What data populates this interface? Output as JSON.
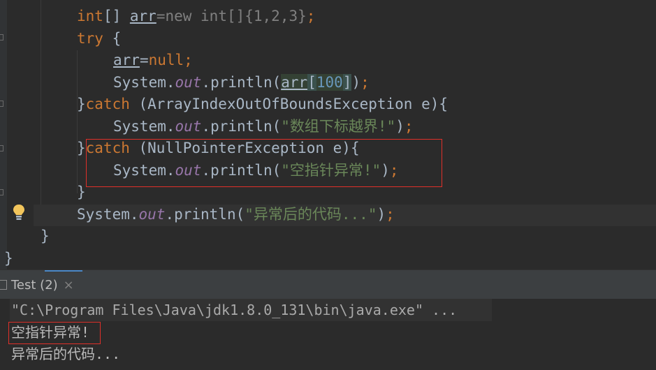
{
  "editor": {
    "lines": {
      "l1": {
        "kw_int": "int",
        "brackets": "[] ",
        "var": "arr",
        "eq": "=",
        "init": "new int[]{1,2,3}",
        "semi": ";"
      },
      "l2": {
        "kw_try": "try",
        "brace": " {"
      },
      "l3": {
        "var": "arr",
        "eq": "=",
        "kw_null": "null",
        "semi": ";"
      },
      "l4": {
        "sys": "System.",
        "out": "out",
        "call": ".println(",
        "var": "arr",
        "open": "[",
        "index": "100",
        "close": "]",
        "paren": ")",
        "semi": ";"
      },
      "l5": {
        "brace": "}",
        "kw_catch": "catch",
        "rest": " (ArrayIndexOutOfBoundsException e){"
      },
      "l6": {
        "sys": "System.",
        "out": "out",
        "call": ".println(",
        "str": "\"数组下标越界!\"",
        "paren": ")",
        "semi": ";"
      },
      "l7": {
        "brace": "}",
        "kw_catch": "catch",
        "rest": " (NullPointerException e){"
      },
      "l8": {
        "sys": "System.",
        "out": "out",
        "call": ".println(",
        "str": "\"空指针异常!\"",
        "paren": ")",
        "semi": ";"
      },
      "l9": {
        "brace": "}"
      },
      "l10": {
        "sys": "System.",
        "out": "out",
        "call": ".println(",
        "str": "\"异常后的代码...\"",
        "paren": ")",
        "semi": ";"
      },
      "l11": {
        "brace": "}"
      },
      "l12": {
        "brace": "}"
      }
    },
    "intention_icon": "lightbulb-icon",
    "colors": {
      "background": "#2b2b2b",
      "keyword": "#cc7832",
      "string": "#6a8759",
      "number": "#6897bb",
      "field": "#9876aa",
      "text": "#a9b7c6",
      "highlight_box": "#e0302a"
    }
  },
  "run_panel": {
    "tab_label": "Test (2)",
    "tab_close": "×",
    "tab_icon": "run-config-icon",
    "console": {
      "command": "\"C:\\Program Files\\Java\\jdk1.8.0_131\\bin\\java.exe\" ...",
      "output_1": "空指针异常!",
      "output_2": "异常后的代码..."
    }
  }
}
